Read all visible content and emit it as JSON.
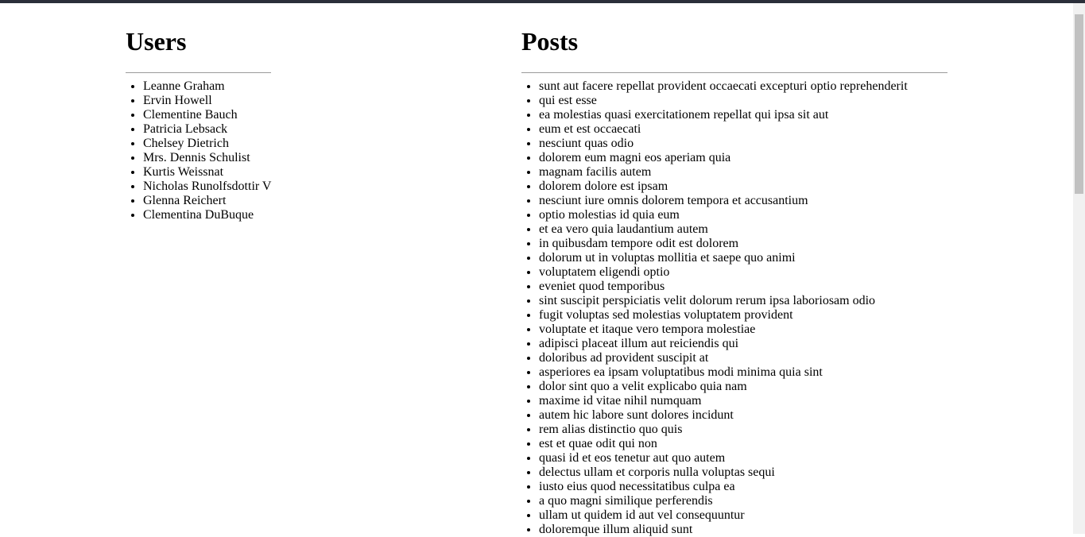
{
  "users_section": {
    "title": "Users",
    "items": [
      "Leanne Graham",
      "Ervin Howell",
      "Clementine Bauch",
      "Patricia Lebsack",
      "Chelsey Dietrich",
      "Mrs. Dennis Schulist",
      "Kurtis Weissnat",
      "Nicholas Runolfsdottir V",
      "Glenna Reichert",
      "Clementina DuBuque"
    ]
  },
  "posts_section": {
    "title": "Posts",
    "items": [
      "sunt aut facere repellat provident occaecati excepturi optio reprehenderit",
      "qui est esse",
      "ea molestias quasi exercitationem repellat qui ipsa sit aut",
      "eum et est occaecati",
      "nesciunt quas odio",
      "dolorem eum magni eos aperiam quia",
      "magnam facilis autem",
      "dolorem dolore est ipsam",
      "nesciunt iure omnis dolorem tempora et accusantium",
      "optio molestias id quia eum",
      "et ea vero quia laudantium autem",
      "in quibusdam tempore odit est dolorem",
      "dolorum ut in voluptas mollitia et saepe quo animi",
      "voluptatem eligendi optio",
      "eveniet quod temporibus",
      "sint suscipit perspiciatis velit dolorum rerum ipsa laboriosam odio",
      "fugit voluptas sed molestias voluptatem provident",
      "voluptate et itaque vero tempora molestiae",
      "adipisci placeat illum aut reiciendis qui",
      "doloribus ad provident suscipit at",
      "asperiores ea ipsam voluptatibus modi minima quia sint",
      "dolor sint quo a velit explicabo quia nam",
      "maxime id vitae nihil numquam",
      "autem hic labore sunt dolores incidunt",
      "rem alias distinctio quo quis",
      "est et quae odit qui non",
      "quasi id et eos tenetur aut quo autem",
      "delectus ullam et corporis nulla voluptas sequi",
      "iusto eius quod necessitatibus culpa ea",
      "a quo magni similique perferendis",
      "ullam ut quidem id aut vel consequuntur",
      "doloremque illum aliquid sunt"
    ]
  }
}
